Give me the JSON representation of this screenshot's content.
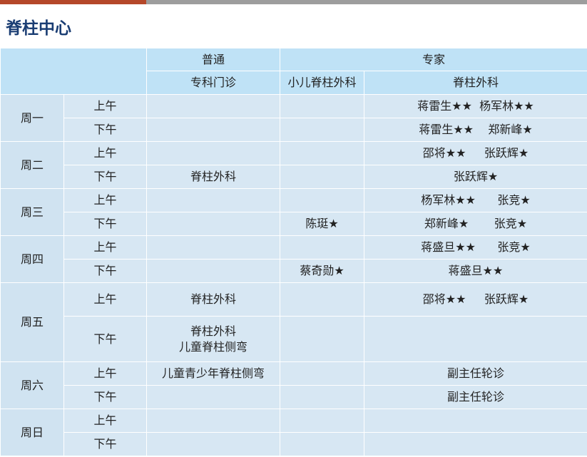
{
  "title": "脊柱中心",
  "colors": {
    "accent_left": "#b5482a",
    "accent_right": "#9d9d9d",
    "title": "#1a3d73",
    "header_bg": "#bfe2f6",
    "cell_bg": "#d7e7f3"
  },
  "header": {
    "group_general": "普通",
    "group_expert": "专家",
    "col_general": "专科门诊",
    "col_pediatric": "小儿脊柱外科",
    "col_spine": "脊柱外科"
  },
  "rows": [
    {
      "day": "周一",
      "am": "上午",
      "pm": "下午",
      "am_general": "",
      "am_pediatric": "",
      "am_spine": "蒋雷生★★  杨军林★★",
      "pm_general": "",
      "pm_pediatric": "",
      "pm_spine": "蒋雷生★★    郑新峰★"
    },
    {
      "day": "周二",
      "am": "上午",
      "pm": "下午",
      "am_general": "",
      "am_pediatric": "",
      "am_spine": "邵将★★     张跃辉★",
      "pm_general": "脊柱外科",
      "pm_pediatric": "",
      "pm_spine": "张跃辉★"
    },
    {
      "day": "周三",
      "am": "上午",
      "pm": "下午",
      "am_general": "",
      "am_pediatric": "",
      "am_spine": "杨军林★★      张竞★",
      "pm_general": "",
      "pm_pediatric": "陈珽★",
      "pm_spine": "郑新峰★       张竞★"
    },
    {
      "day": "周四",
      "am": "上午",
      "pm": "下午",
      "am_general": "",
      "am_pediatric": "",
      "am_spine": "蒋盛旦★★      张竞★",
      "pm_general": "",
      "pm_pediatric": "蔡奇勋★",
      "pm_spine": "蒋盛旦★★"
    },
    {
      "day": "周五",
      "am": "上午",
      "pm": "下午",
      "am_general": "脊柱外科",
      "am_pediatric": "",
      "am_spine": "邵将★★     张跃辉★",
      "pm_general": "脊柱外科",
      "pm_general_2": "儿童脊柱侧弯",
      "pm_pediatric": "",
      "pm_spine": ""
    },
    {
      "day": "周六",
      "am": "上午",
      "pm": "下午",
      "am_general": "儿童青少年脊柱侧弯",
      "am_pediatric": "",
      "am_spine": "副主任轮诊",
      "pm_general": "",
      "pm_pediatric": "",
      "pm_spine": "副主任轮诊"
    },
    {
      "day": "周日",
      "am": "上午",
      "pm": "下午",
      "am_general": "",
      "am_pediatric": "",
      "am_spine": "",
      "pm_general": "",
      "pm_pediatric": "",
      "pm_spine": ""
    }
  ]
}
